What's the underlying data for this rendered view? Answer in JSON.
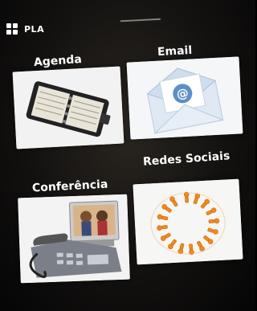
{
  "status": {
    "title": "PLA",
    "logo_icon": "windows-logo-icon"
  },
  "tiles": [
    {
      "label": "Agenda",
      "icon": "planner-book-icon"
    },
    {
      "label": "Email",
      "icon": "email-envelope-icon"
    },
    {
      "label": "Conferência",
      "icon": "conference-phone-icon"
    },
    {
      "label": "Redes Sociais",
      "icon": "social-network-circle-icon"
    }
  ]
}
